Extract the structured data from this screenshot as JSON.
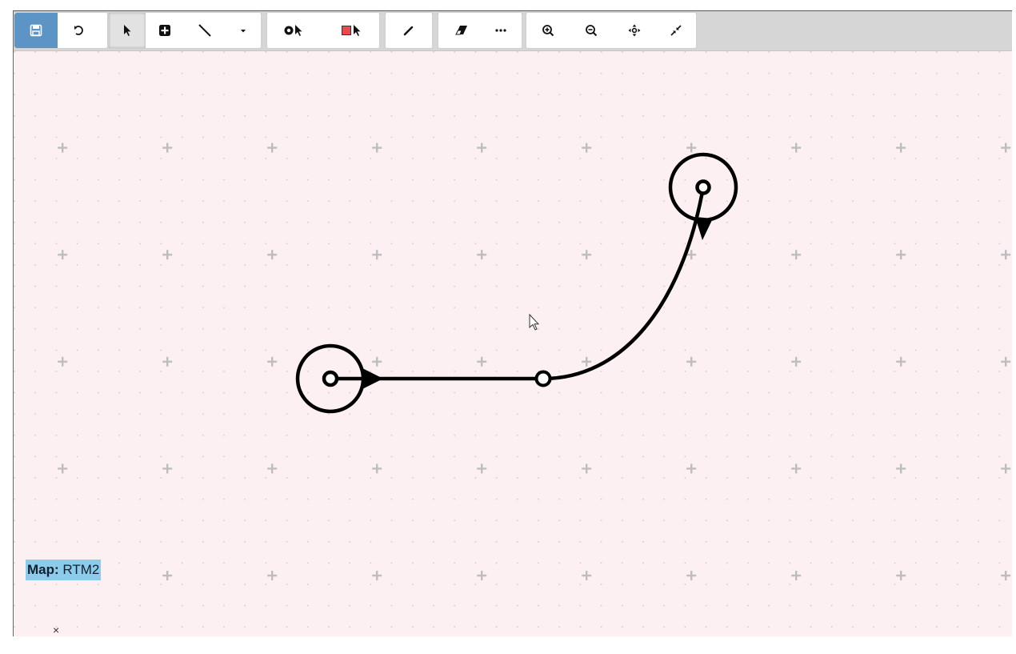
{
  "window": {
    "close_glyph": "×"
  },
  "toolbar": {
    "groups": [
      {
        "name": "file",
        "buttons": [
          {
            "id": "save",
            "icon": "save-icon",
            "tooltip": ""
          },
          {
            "id": "undo",
            "icon": "undo-icon",
            "tooltip": ""
          }
        ]
      },
      {
        "name": "tools",
        "buttons": [
          {
            "id": "select",
            "icon": "pointer-icon",
            "active": true
          },
          {
            "id": "add-node",
            "icon": "plus-square-icon"
          },
          {
            "id": "line",
            "icon": "line-icon"
          },
          {
            "id": "line-dropdown",
            "icon": "caret-down-icon"
          }
        ]
      },
      {
        "name": "selection",
        "buttons": [
          {
            "id": "select-point",
            "icon": "point-select-icon"
          },
          {
            "id": "select-area",
            "icon": "area-select-icon"
          }
        ]
      },
      {
        "name": "edit",
        "buttons": [
          {
            "id": "pencil",
            "icon": "pencil-icon"
          }
        ]
      },
      {
        "name": "erase",
        "buttons": [
          {
            "id": "eraser",
            "icon": "eraser-icon"
          },
          {
            "id": "more",
            "icon": "ellipsis-icon"
          }
        ]
      },
      {
        "name": "view",
        "buttons": [
          {
            "id": "zoom-in",
            "icon": "zoom-in-icon"
          },
          {
            "id": "zoom-out",
            "icon": "zoom-out-icon"
          },
          {
            "id": "fit",
            "icon": "fit-view-icon"
          },
          {
            "id": "collapse",
            "icon": "collapse-icon"
          }
        ]
      }
    ]
  },
  "canvas": {
    "background": "#fcf0f3",
    "grid_color": "#c9c9c9",
    "stroke_color": "#000000"
  },
  "map": {
    "prefix": "Map:",
    "name": "RTM2",
    "highlight_color": "#8ccbea"
  }
}
